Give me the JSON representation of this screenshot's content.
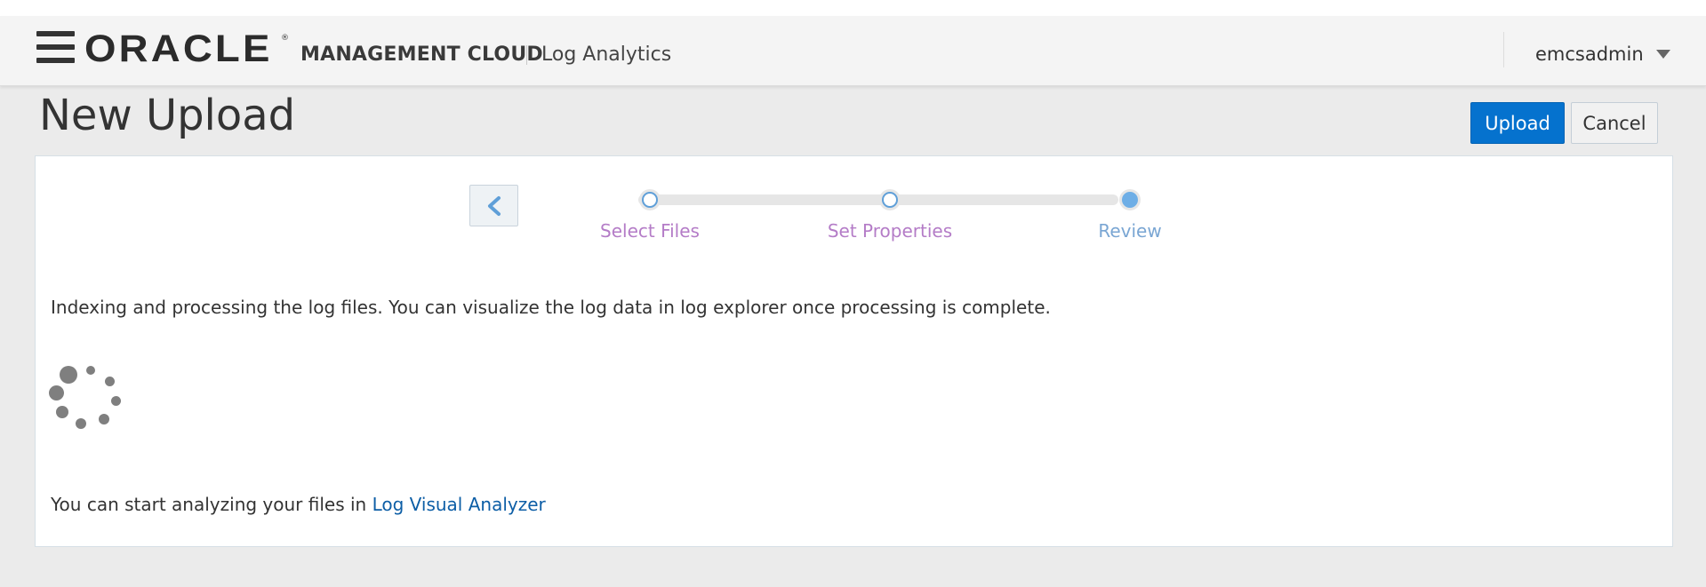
{
  "header": {
    "logo_text": "ORACLE",
    "logo_mark": "®",
    "product_name": "MANAGEMENT CLOUD",
    "app_name": "Log Analytics",
    "user_name": "emcsadmin",
    "menu_icon": "hamburger-menu-icon",
    "user_menu_icon": "caret-down-icon"
  },
  "page": {
    "title": "New Upload"
  },
  "toolbar": {
    "upload_label": "Upload",
    "cancel_label": "Cancel"
  },
  "wizard": {
    "back_icon": "chevron-left-icon",
    "steps": [
      {
        "label": "Select Files",
        "state": "visited"
      },
      {
        "label": "Set Properties",
        "state": "visited"
      },
      {
        "label": "Review",
        "state": "current"
      }
    ]
  },
  "content": {
    "status_message": "Indexing and processing the log files. You can visualize the log data in log explorer once processing is complete.",
    "spinner_icon": "loading-spinner-icon",
    "footer_prefix": "You can start analyzing your files in ",
    "footer_link": "Log Visual Analyzer"
  },
  "colors": {
    "primary_button": "#0572ce",
    "link": "#0d5ea6",
    "step_visited_label": "#b47cc7",
    "step_current_label": "#7aa6d3",
    "step_dot": "#6eaee6"
  }
}
